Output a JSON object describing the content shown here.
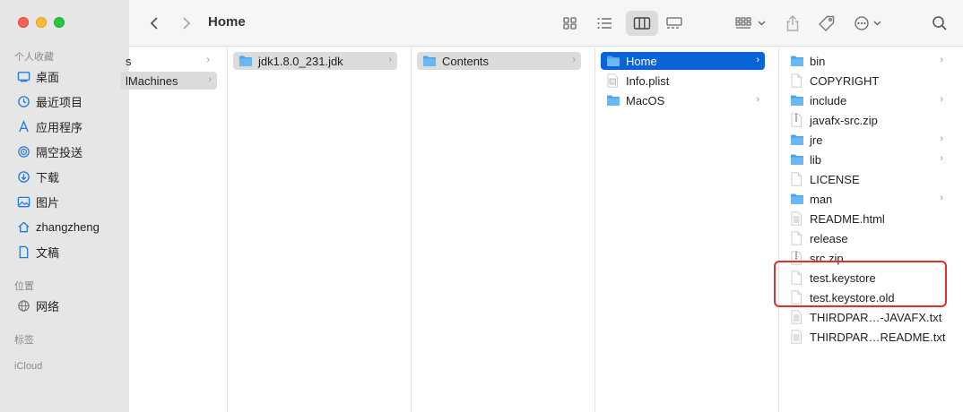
{
  "window": {
    "title": "Home"
  },
  "sidebar": {
    "sections": [
      {
        "label": "个人收藏",
        "items": [
          {
            "label": "桌面",
            "icon": "desktop-icon"
          },
          {
            "label": "最近项目",
            "icon": "clock-icon"
          },
          {
            "label": "应用程序",
            "icon": "apps-icon"
          },
          {
            "label": "隔空投送",
            "icon": "airdrop-icon"
          },
          {
            "label": "下载",
            "icon": "download-icon"
          },
          {
            "label": "图片",
            "icon": "photo-icon"
          },
          {
            "label": "zhangzheng",
            "icon": "home-icon"
          },
          {
            "label": "文稿",
            "icon": "document-icon"
          }
        ]
      },
      {
        "label": "位置",
        "items": [
          {
            "label": "网络",
            "icon": "network-icon"
          }
        ]
      },
      {
        "label": "标签",
        "items": []
      },
      {
        "label": "iCloud",
        "items": []
      }
    ]
  },
  "columns": [
    {
      "items": [
        {
          "label": "s",
          "kind": "partial",
          "chevron": true
        },
        {
          "label": "lMachines",
          "kind": "partial",
          "chevron": true,
          "selected": "gray"
        }
      ]
    },
    {
      "items": [
        {
          "label": "jdk1.8.0_231.jdk",
          "kind": "folder",
          "chevron": true,
          "selected": "gray"
        }
      ]
    },
    {
      "items": [
        {
          "label": "Contents",
          "kind": "folder",
          "chevron": true,
          "selected": "gray"
        }
      ]
    },
    {
      "items": [
        {
          "label": "Home",
          "kind": "folder",
          "chevron": true,
          "selected": "blue"
        },
        {
          "label": "Info.plist",
          "kind": "plist",
          "chevron": false
        },
        {
          "label": "MacOS",
          "kind": "folder",
          "chevron": true
        }
      ]
    },
    {
      "items": [
        {
          "label": "bin",
          "kind": "folder",
          "chevron": true
        },
        {
          "label": "COPYRIGHT",
          "kind": "file",
          "chevron": false
        },
        {
          "label": "include",
          "kind": "folder",
          "chevron": true
        },
        {
          "label": "javafx-src.zip",
          "kind": "zip",
          "chevron": false
        },
        {
          "label": "jre",
          "kind": "folder",
          "chevron": true
        },
        {
          "label": "lib",
          "kind": "folder",
          "chevron": true
        },
        {
          "label": "LICENSE",
          "kind": "file",
          "chevron": false
        },
        {
          "label": "man",
          "kind": "folder",
          "chevron": true
        },
        {
          "label": "README.html",
          "kind": "text",
          "chevron": false
        },
        {
          "label": "release",
          "kind": "file",
          "chevron": false
        },
        {
          "label": "src.zip",
          "kind": "zip",
          "chevron": false
        },
        {
          "label": "test.keystore",
          "kind": "file",
          "chevron": false
        },
        {
          "label": "test.keystore.old",
          "kind": "file",
          "chevron": false
        },
        {
          "label": "THIRDPAR…-JAVAFX.txt",
          "kind": "text",
          "chevron": false
        },
        {
          "label": "THIRDPAR…README.txt",
          "kind": "text",
          "chevron": false
        }
      ]
    }
  ],
  "colors": {
    "selection_blue": "#0a64d8",
    "folder_blue": "#4aa5ea",
    "annotation_red": "#e0302c"
  }
}
